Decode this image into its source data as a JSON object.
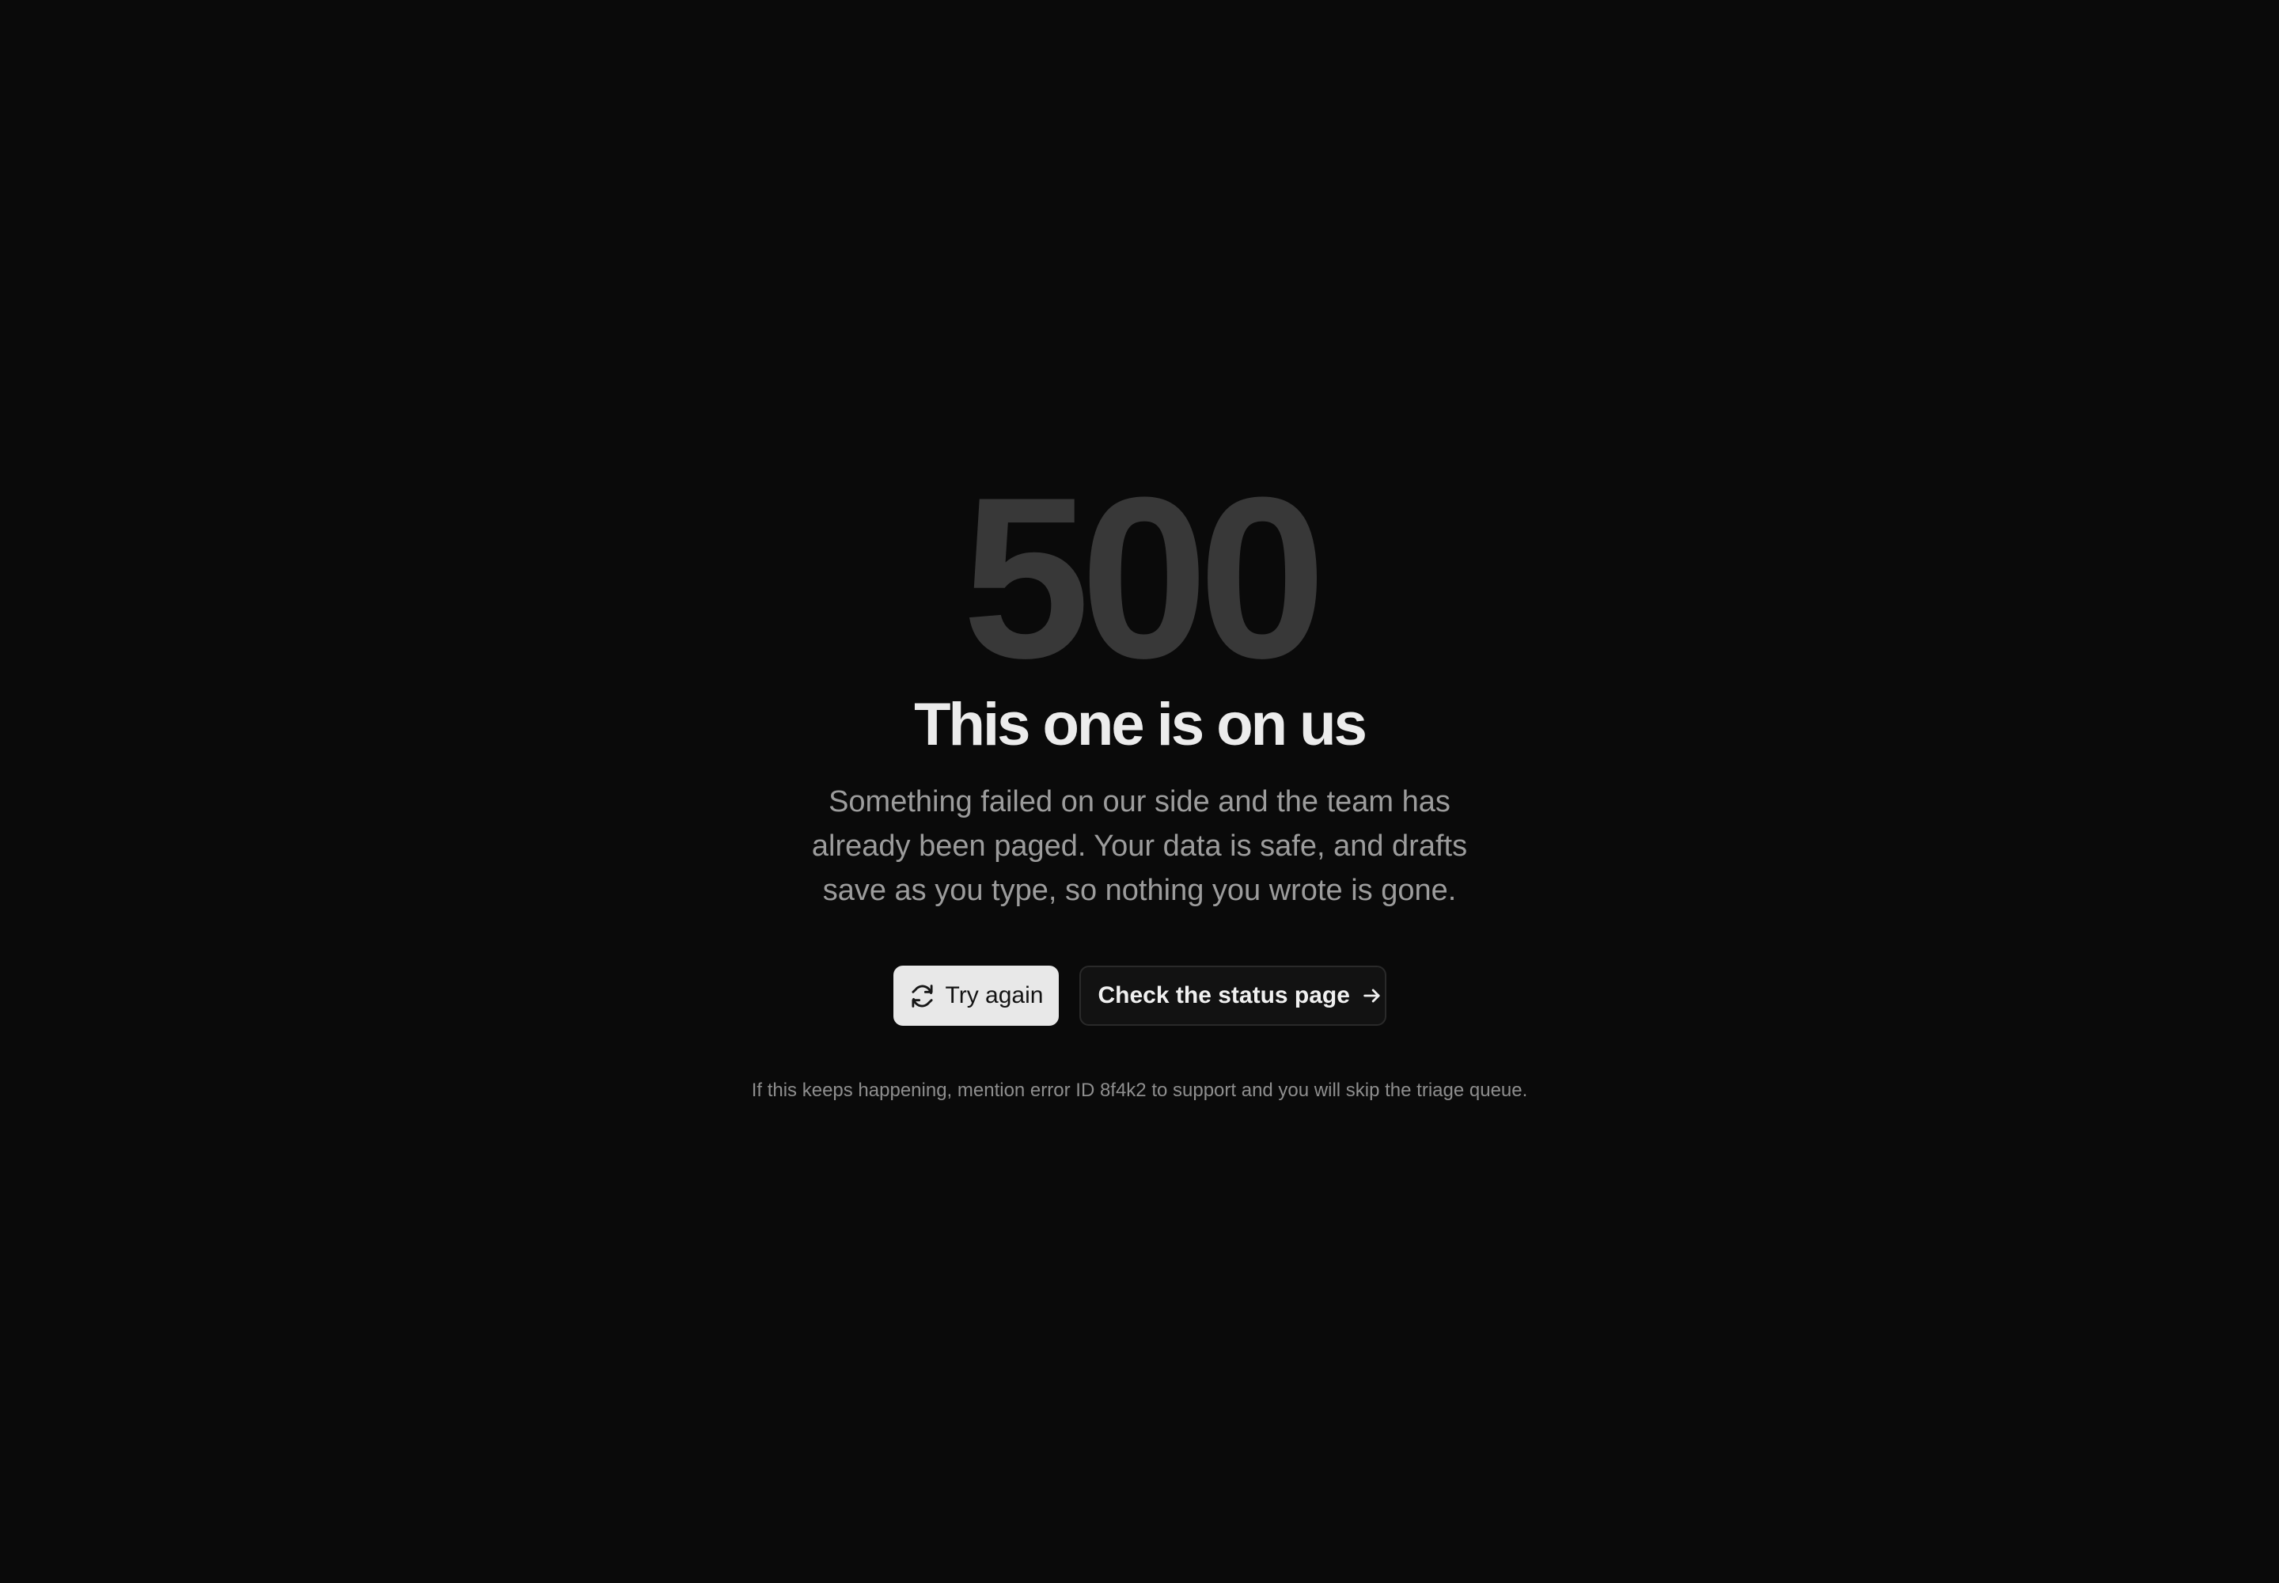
{
  "error": {
    "code": "500",
    "title": "This one is on us",
    "message": "Something failed on our side and the team has already been paged. Your data is safe, and drafts save as you type, so nothing you wrote is gone."
  },
  "actions": {
    "retry": {
      "label": "Try again",
      "icon": "refresh-icon"
    },
    "status": {
      "label": "Check the status page",
      "icon": "arrow-right-icon"
    }
  },
  "footnote": "If this keeps happening, mention error ID 8f4k2 to support and you will skip the triage queue.",
  "colors": {
    "background": "#0a0a0a",
    "primary_button": "#e8e8e8",
    "secondary_button": "#121212",
    "muted_text": "#9c9c9c"
  }
}
